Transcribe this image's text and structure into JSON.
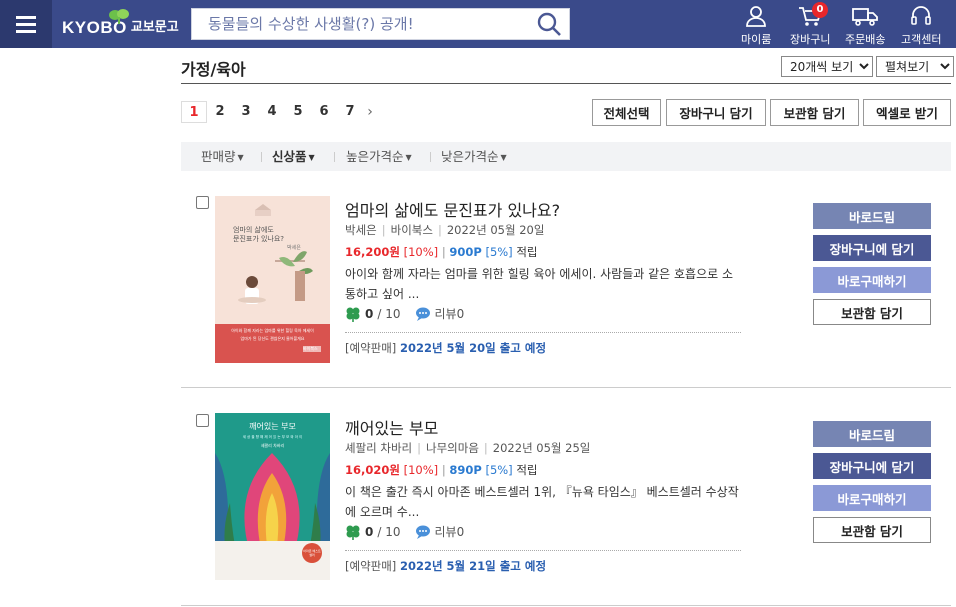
{
  "header": {
    "logo_text": "KYOBO",
    "logo_kr": "교보문고",
    "search_placeholder": "동물들의 수상한 사생활(?) 공개!",
    "nav": {
      "mypage": "마이룸",
      "cart": "장바구니",
      "cart_count": "0",
      "order": "주문배송",
      "support": "고객센터"
    }
  },
  "page": {
    "title": "가정/육아",
    "per_page": "20개씩 보기",
    "view_mode": "펼쳐보기"
  },
  "pagination": {
    "pages": [
      "1",
      "2",
      "3",
      "4",
      "5",
      "6",
      "7"
    ],
    "next": "›"
  },
  "toolbar": {
    "select_all": "전체선택",
    "add_cart": "장바구니 담기",
    "add_wishlist": "보관함 담기",
    "excel": "엑셀로 받기"
  },
  "sort": {
    "sales": "판매량",
    "new": "신상품",
    "price_high": "높은가격순",
    "price_low": "낮은가격순"
  },
  "items": [
    {
      "title": "엄마의 삶에도 문진표가 있나요?",
      "author": "박세은",
      "publisher": "바이북스",
      "date": "2022년 05월 20일",
      "price": "16,200원",
      "discount": "[10%]",
      "points": "900P",
      "points_rate": "[5%]",
      "points_label": "적립",
      "desc": "아이와 함께 자라는 엄마를 위한 힐링 육아 에세이. 사람들과 같은 호흡으로 소통하고 싶어 ...",
      "rating": "0",
      "rating_max": "/ 10",
      "review": "리뷰0",
      "release_tag": "[예약판매]",
      "release_date": "2022년 5월 20일 출고 예정",
      "cover_title": "엄마의 삶에도\n문진표가 있나요?",
      "cover_author": "박세은",
      "cover_tagline": "아이와 함께 자라는 엄마를 위한 힐링 육아 에세이",
      "cover_tagline2": "엄마가 된 당신도 괜찮은지 물어볼게요",
      "cover_publisher": "바이북스",
      "buttons": [
        "바로드림",
        "장바구니에 담기",
        "바로구매하기",
        "보관함 담기"
      ]
    },
    {
      "title": "깨어있는 부모",
      "author": "셰팔리 차바리",
      "publisher": "나무의마음",
      "date": "2022년 05월 25일",
      "price": "16,020원",
      "discount": "[10%]",
      "points": "890P",
      "points_rate": "[5%]",
      "points_label": "적립",
      "desc": "이 책은 출간 즉시 아마존 베스트셀러 1위, 『뉴욕 타임스』 베스트셀러 수상작에 오르며 수...",
      "rating": "0",
      "rating_max": "/ 10",
      "review": "리뷰0",
      "release_tag": "[예약판매]",
      "release_date": "2022년 5월 21일 출고 예정",
      "cover_title": "깨어있는 부모",
      "cover_sub": "세 상 을 향 해 깨 어 있 는 부 모 와 아 이",
      "cover_author": "셰팔리 차바리",
      "cover_badge": "아마존 베스트셀러",
      "buttons": [
        "바로드림",
        "장바구니에 담기",
        "바로구매하기",
        "보관함 담기"
      ]
    }
  ],
  "colors": {
    "header_bg": "#3a4a8a",
    "price_red": "#e8272b",
    "points_blue": "#2a7ad0"
  }
}
